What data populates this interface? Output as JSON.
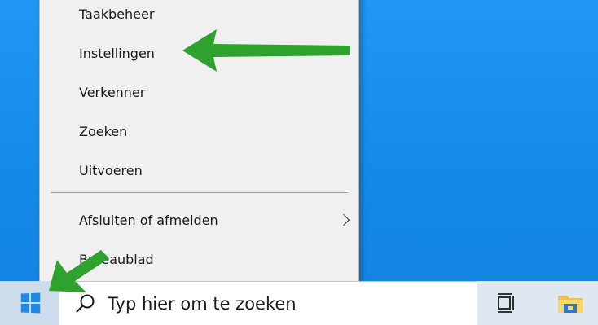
{
  "context_menu": {
    "items": [
      {
        "label": "Taakbeheer"
      },
      {
        "label": "Instellingen"
      },
      {
        "label": "Verkenner"
      },
      {
        "label": "Zoeken"
      },
      {
        "label": "Uitvoeren"
      },
      {
        "label": "Afsluiten of afmelden",
        "has_submenu": true
      },
      {
        "label": "Bureaublad"
      }
    ]
  },
  "taskbar": {
    "start_icon": "windows-logo-icon",
    "search": {
      "placeholder": "Typ hier om te zoeken",
      "icon": "search-icon"
    },
    "icons": [
      "task-view-icon",
      "file-explorer-icon"
    ]
  },
  "annotations": {
    "arrow_color": "#2ea12e"
  },
  "colors": {
    "desktop": "#1a8cf0",
    "menu_bg": "#f0f0f0",
    "taskbar_bg": "#dfe8f1",
    "accent": "#1e88e5"
  }
}
